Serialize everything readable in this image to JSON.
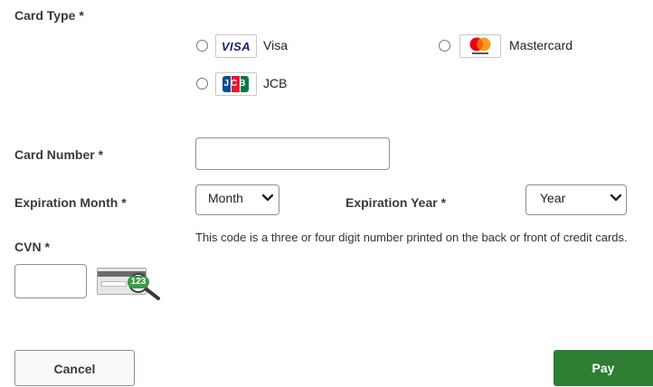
{
  "card_type": {
    "label": "Card Type *",
    "options": [
      {
        "name": "Visa",
        "logo_text": "VISA"
      },
      {
        "name": "Mastercard"
      },
      {
        "name": "JCB",
        "logo_text": "JCB"
      }
    ]
  },
  "card_number": {
    "label": "Card Number *",
    "value": ""
  },
  "expiration_month": {
    "label": "Expiration Month *",
    "selected": "Month"
  },
  "expiration_year": {
    "label": "Expiration Year *",
    "selected": "Year"
  },
  "cvn": {
    "label": "CVN *",
    "value": "",
    "help": "This code is a three or four digit number printed on the back or front of credit cards.",
    "image_code": "123"
  },
  "actions": {
    "cancel_label": "Cancel",
    "pay_label": "Pay"
  },
  "colors": {
    "pay_button": "#2e7d32",
    "visa_blue": "#1a1f71",
    "mastercard_red": "#eb001b",
    "mastercard_orange": "#f79e1b",
    "cvn_badge": "#3a9a4a"
  }
}
